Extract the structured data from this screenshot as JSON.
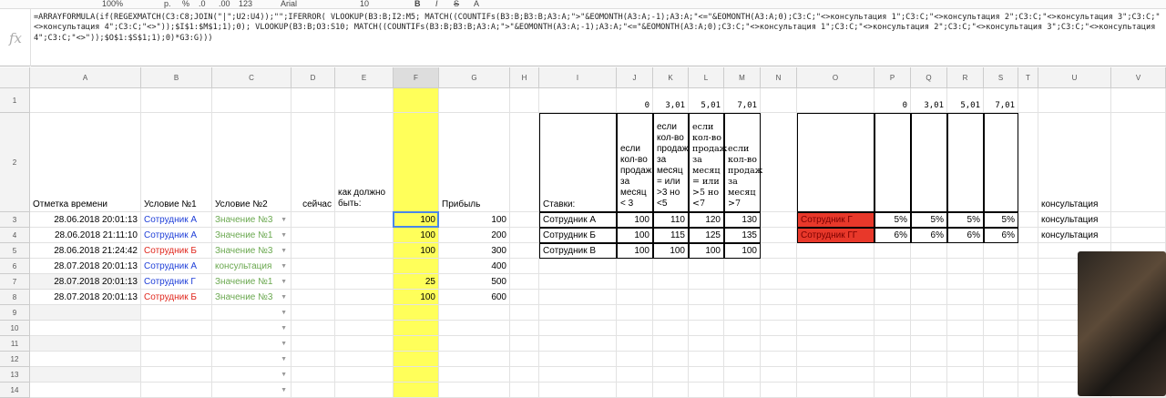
{
  "toolbar": {
    "zoom": "100%",
    "currency": "р.",
    "percent": "%",
    "dec_less": ".0",
    "dec_more": ".00",
    "format": "123",
    "font": "Arial",
    "font_size": "10",
    "bold": "B",
    "italic": "I",
    "strike": "S",
    "text_color": "A"
  },
  "formula_bar": {
    "icon": "fx",
    "formula": "=ARRAYFORMULA(if(REGEXMATCH(C3:C8;JOIN(\"|\";U2:U4));\"\";IFERROR( VLOOKUP(B3:B;I2:M5; MATCH((COUNTIFs(B3:B;B3:B;A3:A;\">\"&EOMONTH(A3:A;-1);A3:A;\"<=\"&EOMONTH(A3:A;0);C3:C;\"<>консультация 1\";C3:C;\"<>консультация 2\";C3:C;\"<>консультация 3\";C3:C;\"<>консультация 4\";C3:C;\"<>\"));$I$1:$M$1;1);0); VLOOKUP(B3:B;O3:S10; MATCH((COUNTIFs(B3:B;B3:B;A3:A;\">\"&EOMONTH(A3:A;-1);A3:A;\"<=\"&EOMONTH(A3:A;0);C3:C;\"<>консультация 1\";C3:C;\"<>консультация 2\";C3:C;\"<>консультация 3\";C3:C;\"<>консультация 4\";C3:C;\"<>\"));$O$1:$S$1;1);0)*G3:G)))"
  },
  "columns": [
    "A",
    "B",
    "C",
    "D",
    "E",
    "F",
    "G",
    "H",
    "I",
    "J",
    "K",
    "L",
    "M",
    "N",
    "O",
    "P",
    "Q",
    "R",
    "S",
    "T",
    "U",
    "V"
  ],
  "rows": [
    "1",
    "2",
    "3",
    "4",
    "5",
    "6",
    "7",
    "8",
    "9",
    "10",
    "11",
    "12",
    "13",
    "14"
  ],
  "colors": {
    "highlight_yellow": "#ffff5a",
    "employee_blue": "#1f3fd8",
    "employee_red": "#e0281e",
    "value_green": "#6aa84f",
    "red_fill": "#e8382a"
  },
  "headers": {
    "A": "Отметка времени",
    "B": "Условие №1",
    "C": "Условие №2",
    "D": "сейчас",
    "E": "как должно быть:",
    "G": "Прибыль"
  },
  "data_rows": [
    {
      "A": "28.06.2018 20:01:13",
      "B": "Сотрудник А",
      "B_color": "blue",
      "C": "Значение №3",
      "F": "100",
      "G": "100"
    },
    {
      "A": "28.06.2018 21:11:10",
      "B": "Сотрудник А",
      "B_color": "blue",
      "C": "Значение №1",
      "F": "100",
      "G": "200"
    },
    {
      "A": "28.06.2018 21:24:42",
      "B": "Сотрудник Б",
      "B_color": "red",
      "C": "Значение №3",
      "F": "100",
      "G": "300"
    },
    {
      "A": "28.07.2018 20:01:13",
      "B": "Сотрудник А",
      "B_color": "blue",
      "C": "консультация",
      "F": "",
      "G": "400"
    },
    {
      "A": "28.07.2018 20:01:13",
      "B": "Сотрудник Г",
      "B_color": "blue",
      "C": "Значение №1",
      "F": "25",
      "G": "500"
    },
    {
      "A": "28.07.2018 20:01:13",
      "B": "Сотрудник Б",
      "B_color": "red",
      "C": "Значение №3",
      "F": "100",
      "G": "600"
    }
  ],
  "rates": {
    "thresholds": [
      "0",
      "3,01",
      "5,01",
      "7,01"
    ],
    "label": "Ставки:",
    "conditions": [
      "если кол-во продаж за месяц < 3",
      "если кол-во продаж за месяц = или >3 но <5",
      "если кол-во продаж за месяц = или >5 но <7",
      "если кол-во продаж за месяц >7"
    ],
    "rows": [
      {
        "name": "Сотрудник А",
        "values": [
          "100",
          "110",
          "120",
          "130"
        ]
      },
      {
        "name": "Сотрудник Б",
        "values": [
          "100",
          "115",
          "125",
          "135"
        ]
      },
      {
        "name": "Сотрудник В",
        "values": [
          "100",
          "100",
          "100",
          "100"
        ]
      }
    ]
  },
  "percent_rates": {
    "thresholds": [
      "0",
      "3,01",
      "5,01",
      "7,01"
    ],
    "rows": [
      {
        "name": "Сотрудник Г",
        "values": [
          "5%",
          "5%",
          "5%",
          "5%"
        ]
      },
      {
        "name": "Сотрудник ГГ",
        "values": [
          "6%",
          "6%",
          "6%",
          "6%"
        ]
      }
    ]
  },
  "exclusions": [
    "консультация",
    "консультация",
    "консультация"
  ]
}
